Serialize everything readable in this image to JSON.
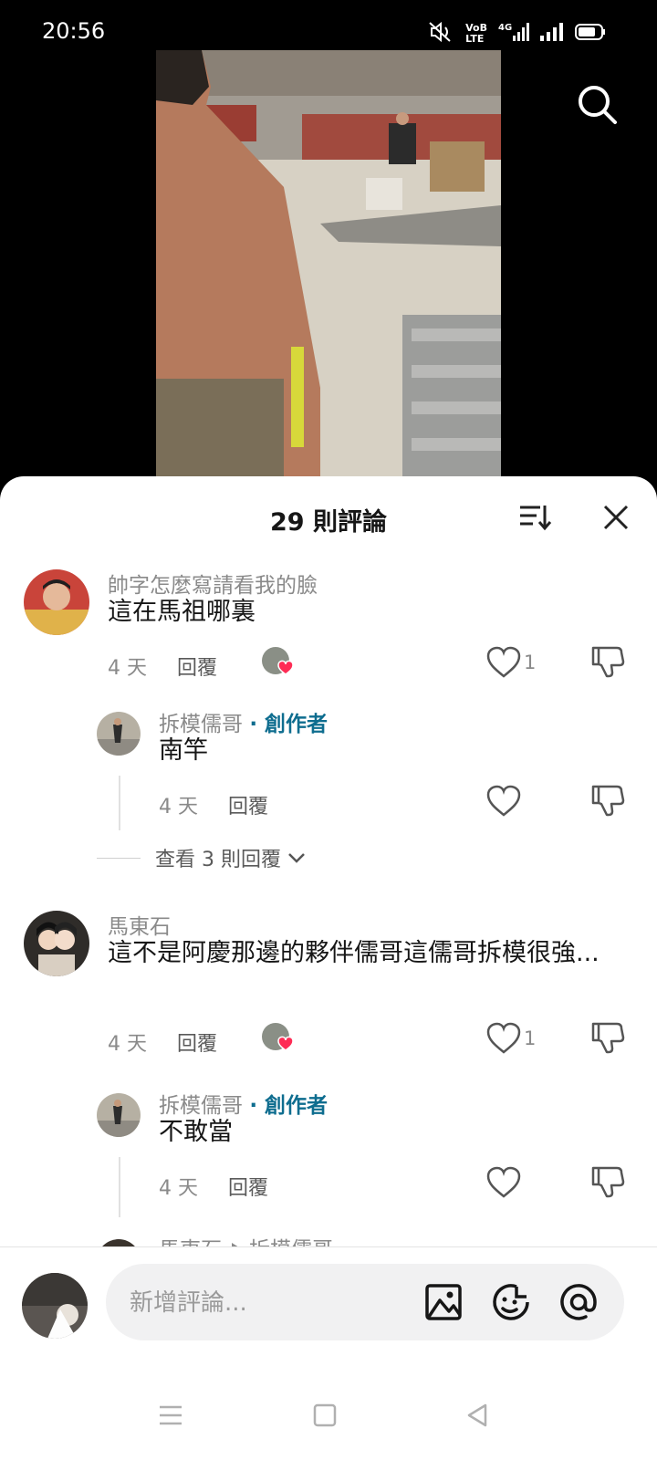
{
  "status": {
    "time": "20:56",
    "network_label": "VoLTE 4G"
  },
  "header": {
    "title": "29 則評論"
  },
  "comments": [
    {
      "user": "帥字怎麼寫請看我的臉",
      "text": "這在馬祖哪裏",
      "age": "4 天",
      "reply_label": "回覆",
      "likes": "1"
    },
    {
      "user": "拆模儒哥",
      "creator_tag": "· 創作者",
      "text": "南竿",
      "age": "4 天",
      "reply_label": "回覆"
    },
    {
      "user": "馬東石",
      "text": "這不是阿慶那邊的夥伴儒哥這儒哥拆模很強...",
      "age": "4 天",
      "reply_label": "回覆",
      "likes": "1"
    },
    {
      "user": "拆模儒哥",
      "creator_tag": "· 創作者",
      "text": "不敢當",
      "age": "4 天",
      "reply_label": "回覆"
    },
    {
      "user": "馬東石",
      "reply_to": "拆模儒哥"
    }
  ],
  "view_replies": "查看 3 則回覆",
  "input": {
    "placeholder": "新增評論..."
  },
  "icons": {
    "search": "search-icon",
    "sort": "sort-icon",
    "close": "close-icon",
    "like": "heart-outline-icon",
    "dislike": "thumbs-down-icon",
    "image": "image-icon",
    "emoji": "emoji-icon",
    "mention": "at-icon"
  },
  "colors": {
    "creator_tag": "#0e6d8f",
    "heart": "#fe2c55"
  }
}
